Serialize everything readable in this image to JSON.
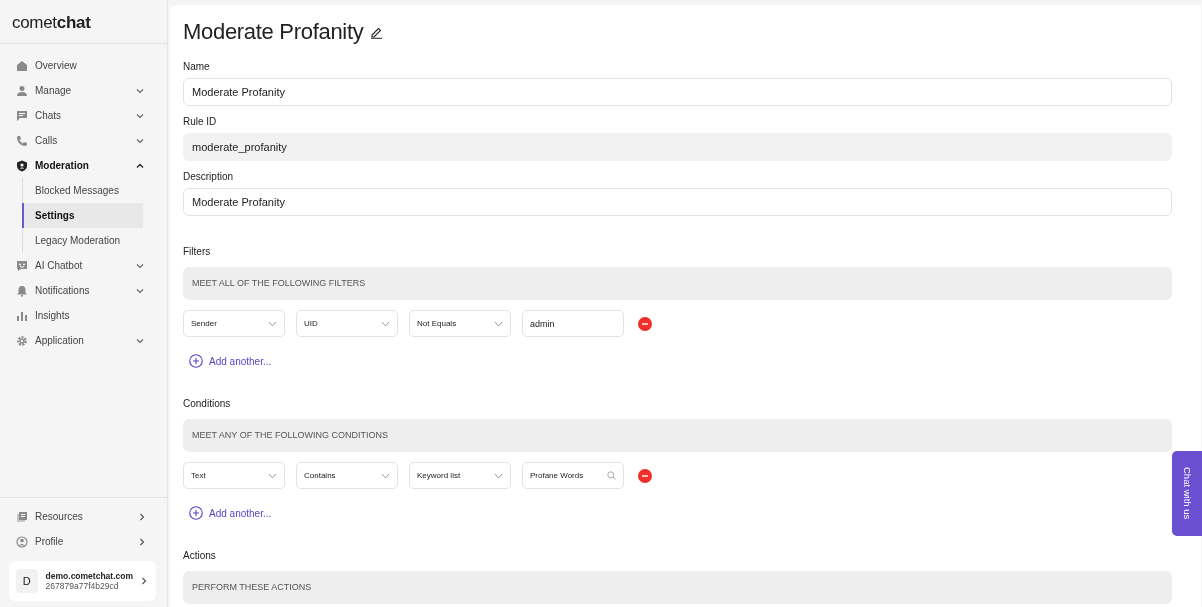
{
  "sidebar": {
    "logo": "comet**chat**",
    "items": [
      {
        "label": "Overview",
        "selected": false
      },
      {
        "label": "Manage",
        "selected": false,
        "expanded": false
      },
      {
        "label": "Chats",
        "selected": false,
        "expanded": false
      },
      {
        "label": "Calls",
        "selected": false,
        "expanded": false
      },
      {
        "label": "Moderation",
        "selected": true,
        "expanded": true,
        "children": [
          {
            "label": "Blocked Messages",
            "selected": false
          },
          {
            "label": "Settings",
            "selected": true
          },
          {
            "label": "Legacy Moderation",
            "selected": false
          }
        ]
      },
      {
        "label": "AI Chatbot",
        "selected": false,
        "expanded": false
      },
      {
        "label": "Notifications",
        "selected": false,
        "expanded": false
      },
      {
        "label": "Insights",
        "selected": false
      },
      {
        "label": "Application",
        "selected": false,
        "expanded": false
      }
    ],
    "footer_items": [
      {
        "label": "Resources"
      },
      {
        "label": "Profile"
      }
    ],
    "account": {
      "initial": "D",
      "name": "demo.cometchat.com",
      "id": "267879a77f4b29cd"
    }
  },
  "main": {
    "title": "Moderate Profanity",
    "fields": [
      {
        "label": "Name",
        "value": "Moderate Profanity",
        "disabled": false
      },
      {
        "label": "Rule ID",
        "value": "moderate_profanity",
        "disabled": true
      },
      {
        "label": "Description",
        "value": "Moderate Profanity",
        "disabled": false
      }
    ],
    "sections": [
      {
        "label": "Filters",
        "banner": "MEET ALL OF THE FOLLOWING FILTERS",
        "rows": [
          {
            "inputs": [
              {
                "kind": "select",
                "value": "Sender"
              },
              {
                "kind": "select",
                "value": "UID"
              },
              {
                "kind": "select",
                "value": "Not Equals"
              },
              {
                "kind": "text",
                "value": "admin"
              }
            ]
          }
        ],
        "add_label": "Add another..."
      },
      {
        "label": "Conditions",
        "banner": "MEET ANY OF THE FOLLOWING CONDITIONS",
        "rows": [
          {
            "inputs": [
              {
                "kind": "select",
                "value": "Text"
              },
              {
                "kind": "select",
                "value": "Contains"
              },
              {
                "kind": "select",
                "value": "Keyword list"
              },
              {
                "kind": "search",
                "value": "Profane Words"
              }
            ]
          }
        ],
        "add_label": "Add another..."
      },
      {
        "label": "Actions",
        "banner": "PERFORM THESE ACTIONS"
      }
    ]
  },
  "chat_button": "Chat with us"
}
